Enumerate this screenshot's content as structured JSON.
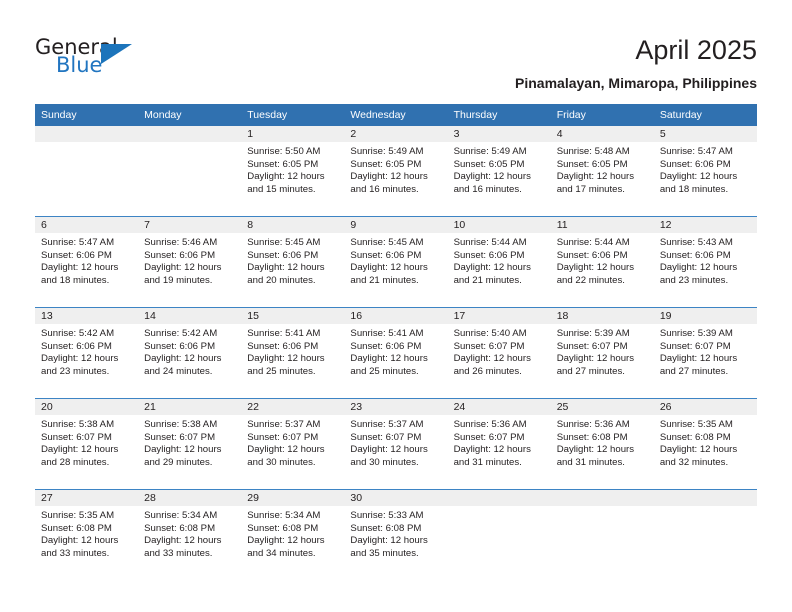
{
  "brand": {
    "name_top": "General",
    "name_bottom": "Blue",
    "triangle_color": "#1c74bb",
    "blue_text_color": "#2175c0"
  },
  "header": {
    "title": "April 2025",
    "subtitle": "Pinamalayan, Mimaropa, Philippines"
  },
  "theme": {
    "header_blue": "#3071b0",
    "row_divider_blue": "#3d84c4",
    "daynum_band_gray": "#efefef"
  },
  "weekdays": [
    "Sunday",
    "Monday",
    "Tuesday",
    "Wednesday",
    "Thursday",
    "Friday",
    "Saturday"
  ],
  "labels": {
    "sunrise_prefix": "Sunrise:",
    "sunset_prefix": "Sunset:",
    "daylight_prefix": "Daylight:"
  },
  "weeks": [
    [
      {
        "day": "",
        "sunrise": "",
        "sunset": "",
        "daylight_line1": "",
        "daylight_line2": ""
      },
      {
        "day": "",
        "sunrise": "",
        "sunset": "",
        "daylight_line1": "",
        "daylight_line2": ""
      },
      {
        "day": "1",
        "sunrise": "Sunrise: 5:50 AM",
        "sunset": "Sunset: 6:05 PM",
        "daylight_line1": "Daylight: 12 hours",
        "daylight_line2": "and 15 minutes."
      },
      {
        "day": "2",
        "sunrise": "Sunrise: 5:49 AM",
        "sunset": "Sunset: 6:05 PM",
        "daylight_line1": "Daylight: 12 hours",
        "daylight_line2": "and 16 minutes."
      },
      {
        "day": "3",
        "sunrise": "Sunrise: 5:49 AM",
        "sunset": "Sunset: 6:05 PM",
        "daylight_line1": "Daylight: 12 hours",
        "daylight_line2": "and 16 minutes."
      },
      {
        "day": "4",
        "sunrise": "Sunrise: 5:48 AM",
        "sunset": "Sunset: 6:05 PM",
        "daylight_line1": "Daylight: 12 hours",
        "daylight_line2": "and 17 minutes."
      },
      {
        "day": "5",
        "sunrise": "Sunrise: 5:47 AM",
        "sunset": "Sunset: 6:06 PM",
        "daylight_line1": "Daylight: 12 hours",
        "daylight_line2": "and 18 minutes."
      }
    ],
    [
      {
        "day": "6",
        "sunrise": "Sunrise: 5:47 AM",
        "sunset": "Sunset: 6:06 PM",
        "daylight_line1": "Daylight: 12 hours",
        "daylight_line2": "and 18 minutes."
      },
      {
        "day": "7",
        "sunrise": "Sunrise: 5:46 AM",
        "sunset": "Sunset: 6:06 PM",
        "daylight_line1": "Daylight: 12 hours",
        "daylight_line2": "and 19 minutes."
      },
      {
        "day": "8",
        "sunrise": "Sunrise: 5:45 AM",
        "sunset": "Sunset: 6:06 PM",
        "daylight_line1": "Daylight: 12 hours",
        "daylight_line2": "and 20 minutes."
      },
      {
        "day": "9",
        "sunrise": "Sunrise: 5:45 AM",
        "sunset": "Sunset: 6:06 PM",
        "daylight_line1": "Daylight: 12 hours",
        "daylight_line2": "and 21 minutes."
      },
      {
        "day": "10",
        "sunrise": "Sunrise: 5:44 AM",
        "sunset": "Sunset: 6:06 PM",
        "daylight_line1": "Daylight: 12 hours",
        "daylight_line2": "and 21 minutes."
      },
      {
        "day": "11",
        "sunrise": "Sunrise: 5:44 AM",
        "sunset": "Sunset: 6:06 PM",
        "daylight_line1": "Daylight: 12 hours",
        "daylight_line2": "and 22 minutes."
      },
      {
        "day": "12",
        "sunrise": "Sunrise: 5:43 AM",
        "sunset": "Sunset: 6:06 PM",
        "daylight_line1": "Daylight: 12 hours",
        "daylight_line2": "and 23 minutes."
      }
    ],
    [
      {
        "day": "13",
        "sunrise": "Sunrise: 5:42 AM",
        "sunset": "Sunset: 6:06 PM",
        "daylight_line1": "Daylight: 12 hours",
        "daylight_line2": "and 23 minutes."
      },
      {
        "day": "14",
        "sunrise": "Sunrise: 5:42 AM",
        "sunset": "Sunset: 6:06 PM",
        "daylight_line1": "Daylight: 12 hours",
        "daylight_line2": "and 24 minutes."
      },
      {
        "day": "15",
        "sunrise": "Sunrise: 5:41 AM",
        "sunset": "Sunset: 6:06 PM",
        "daylight_line1": "Daylight: 12 hours",
        "daylight_line2": "and 25 minutes."
      },
      {
        "day": "16",
        "sunrise": "Sunrise: 5:41 AM",
        "sunset": "Sunset: 6:06 PM",
        "daylight_line1": "Daylight: 12 hours",
        "daylight_line2": "and 25 minutes."
      },
      {
        "day": "17",
        "sunrise": "Sunrise: 5:40 AM",
        "sunset": "Sunset: 6:07 PM",
        "daylight_line1": "Daylight: 12 hours",
        "daylight_line2": "and 26 minutes."
      },
      {
        "day": "18",
        "sunrise": "Sunrise: 5:39 AM",
        "sunset": "Sunset: 6:07 PM",
        "daylight_line1": "Daylight: 12 hours",
        "daylight_line2": "and 27 minutes."
      },
      {
        "day": "19",
        "sunrise": "Sunrise: 5:39 AM",
        "sunset": "Sunset: 6:07 PM",
        "daylight_line1": "Daylight: 12 hours",
        "daylight_line2": "and 27 minutes."
      }
    ],
    [
      {
        "day": "20",
        "sunrise": "Sunrise: 5:38 AM",
        "sunset": "Sunset: 6:07 PM",
        "daylight_line1": "Daylight: 12 hours",
        "daylight_line2": "and 28 minutes."
      },
      {
        "day": "21",
        "sunrise": "Sunrise: 5:38 AM",
        "sunset": "Sunset: 6:07 PM",
        "daylight_line1": "Daylight: 12 hours",
        "daylight_line2": "and 29 minutes."
      },
      {
        "day": "22",
        "sunrise": "Sunrise: 5:37 AM",
        "sunset": "Sunset: 6:07 PM",
        "daylight_line1": "Daylight: 12 hours",
        "daylight_line2": "and 30 minutes."
      },
      {
        "day": "23",
        "sunrise": "Sunrise: 5:37 AM",
        "sunset": "Sunset: 6:07 PM",
        "daylight_line1": "Daylight: 12 hours",
        "daylight_line2": "and 30 minutes."
      },
      {
        "day": "24",
        "sunrise": "Sunrise: 5:36 AM",
        "sunset": "Sunset: 6:07 PM",
        "daylight_line1": "Daylight: 12 hours",
        "daylight_line2": "and 31 minutes."
      },
      {
        "day": "25",
        "sunrise": "Sunrise: 5:36 AM",
        "sunset": "Sunset: 6:08 PM",
        "daylight_line1": "Daylight: 12 hours",
        "daylight_line2": "and 31 minutes."
      },
      {
        "day": "26",
        "sunrise": "Sunrise: 5:35 AM",
        "sunset": "Sunset: 6:08 PM",
        "daylight_line1": "Daylight: 12 hours",
        "daylight_line2": "and 32 minutes."
      }
    ],
    [
      {
        "day": "27",
        "sunrise": "Sunrise: 5:35 AM",
        "sunset": "Sunset: 6:08 PM",
        "daylight_line1": "Daylight: 12 hours",
        "daylight_line2": "and 33 minutes."
      },
      {
        "day": "28",
        "sunrise": "Sunrise: 5:34 AM",
        "sunset": "Sunset: 6:08 PM",
        "daylight_line1": "Daylight: 12 hours",
        "daylight_line2": "and 33 minutes."
      },
      {
        "day": "29",
        "sunrise": "Sunrise: 5:34 AM",
        "sunset": "Sunset: 6:08 PM",
        "daylight_line1": "Daylight: 12 hours",
        "daylight_line2": "and 34 minutes."
      },
      {
        "day": "30",
        "sunrise": "Sunrise: 5:33 AM",
        "sunset": "Sunset: 6:08 PM",
        "daylight_line1": "Daylight: 12 hours",
        "daylight_line2": "and 35 minutes."
      },
      {
        "day": "",
        "sunrise": "",
        "sunset": "",
        "daylight_line1": "",
        "daylight_line2": ""
      },
      {
        "day": "",
        "sunrise": "",
        "sunset": "",
        "daylight_line1": "",
        "daylight_line2": ""
      },
      {
        "day": "",
        "sunrise": "",
        "sunset": "",
        "daylight_line1": "",
        "daylight_line2": ""
      }
    ]
  ]
}
